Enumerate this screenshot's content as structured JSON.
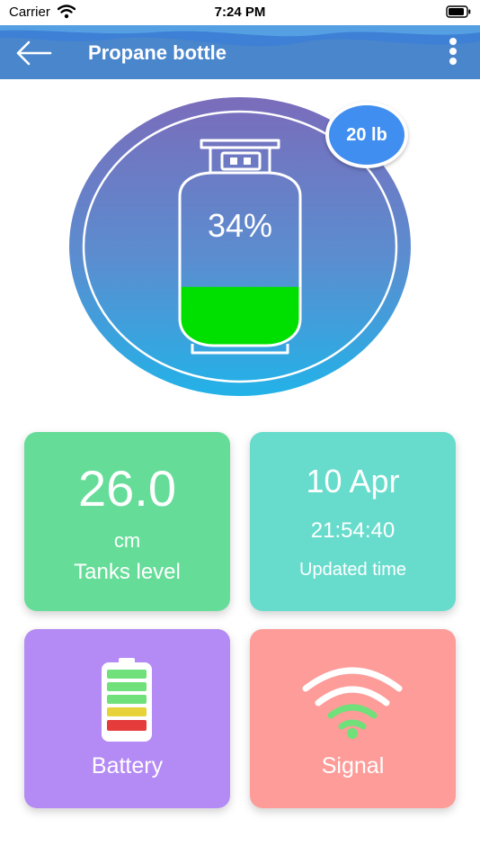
{
  "status_bar": {
    "carrier": "Carrier",
    "time": "7:24 PM"
  },
  "header": {
    "title": "Propane bottle",
    "back_icon": "arrow-left-icon",
    "menu_icon": "more-vertical-icon"
  },
  "tank": {
    "percent_label": "34%",
    "fill_fraction": 0.34,
    "size_label": "20 lb"
  },
  "cards": {
    "level": {
      "value": "26.0",
      "unit": "cm",
      "label": "Tanks level"
    },
    "updated": {
      "date": "10 Apr",
      "time": "21:54:40",
      "label": "Updated time"
    },
    "battery": {
      "label": "Battery",
      "icon": "battery-icon"
    },
    "signal": {
      "label": "Signal",
      "icon": "wifi-signal-icon"
    }
  },
  "colors": {
    "header": "#4a86cc",
    "tank_fill": "#00e000",
    "badge": "#3f8ef0",
    "card_level": "#66dc99",
    "card_updated": "#68dccc",
    "card_battery": "#b48af5",
    "card_signal": "#fd9c99"
  }
}
